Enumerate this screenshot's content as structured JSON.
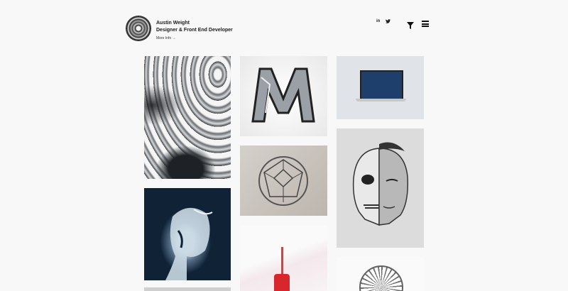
{
  "header": {
    "name": "Austin Weight",
    "role": "Designer & Front End Developer",
    "more_link": "More Info →",
    "social": {
      "linkedin": "in",
      "twitter": "🐦"
    },
    "icons": {
      "logo": "circular-logo",
      "filter": "filter-icon",
      "menu": "hamburger-menu-icon"
    }
  },
  "portfolio": {
    "tiles": [
      {
        "subject": "hurricane-satellite"
      },
      {
        "subject": "hooded-figure"
      },
      {
        "subject": "letter-m-sculpture"
      },
      {
        "subject": "geometric-polyhedron"
      },
      {
        "subject": "red-popsicle"
      },
      {
        "subject": "laptop-mockup"
      },
      {
        "subject": "half-skull-portrait"
      },
      {
        "subject": "wireframe-sphere"
      }
    ]
  }
}
